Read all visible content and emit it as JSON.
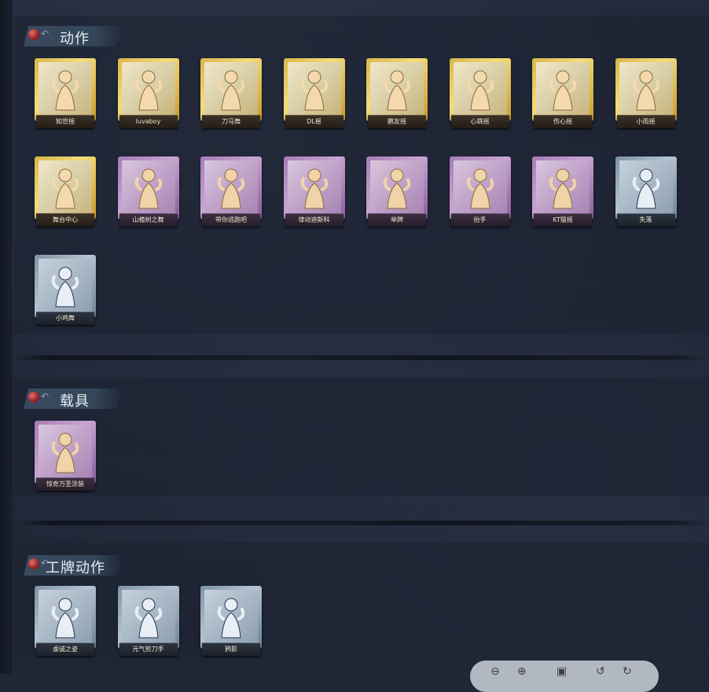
{
  "sections": [
    {
      "title": "动作",
      "items": [
        {
          "label": "知世摇",
          "rarity": "gold"
        },
        {
          "label": "luvaboy",
          "rarity": "gold"
        },
        {
          "label": "刀马舞",
          "rarity": "gold"
        },
        {
          "label": "DL摇",
          "rarity": "gold"
        },
        {
          "label": "鹏友摇",
          "rarity": "gold"
        },
        {
          "label": "心跳摇",
          "rarity": "gold"
        },
        {
          "label": "伤心摇",
          "rarity": "gold"
        },
        {
          "label": "小雨摇",
          "rarity": "gold"
        },
        {
          "label": "舞台中心",
          "rarity": "gold"
        },
        {
          "label": "山楂树之舞",
          "rarity": "purple"
        },
        {
          "label": "带你逃跑吧",
          "rarity": "purple"
        },
        {
          "label": "律动迪斯科",
          "rarity": "purple"
        },
        {
          "label": "举牌",
          "rarity": "purple"
        },
        {
          "label": "抬手",
          "rarity": "purple"
        },
        {
          "label": "KT猫摇",
          "rarity": "purple"
        },
        {
          "label": "失落",
          "rarity": "blue"
        },
        {
          "label": "小鸡舞",
          "rarity": "blue"
        }
      ]
    },
    {
      "title": "载具",
      "items": [
        {
          "label": "惊奇万圣涂装",
          "rarity": "purple"
        }
      ]
    },
    {
      "title": "工牌动作",
      "items": [
        {
          "label": "虔诚之姿",
          "rarity": "blue"
        },
        {
          "label": "元气剪刀手",
          "rarity": "blue"
        },
        {
          "label": "鸦影",
          "rarity": "blue"
        }
      ]
    }
  ],
  "toolbar": {
    "icons": [
      "zoom-out-icon",
      "zoom-in-icon",
      "fit-icon",
      "rotate-left-icon",
      "rotate-right-icon"
    ]
  },
  "colors": {
    "background": "#1f2636",
    "gold": "#e1c05a",
    "purple": "#b48cc3",
    "blue": "#9eb0c2"
  }
}
